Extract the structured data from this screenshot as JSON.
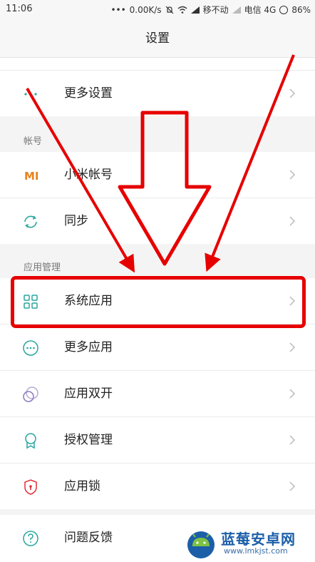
{
  "status_bar": {
    "time": "11:06",
    "dots": "•••",
    "speed": "0.00K/s",
    "carrier1": "移不动",
    "carrier2": "电信 4G",
    "battery": "86%"
  },
  "title": "设置",
  "sections": {
    "more_settings": "更多设置",
    "account_header": "帐号",
    "mi_account": "小米帐号",
    "sync": "同步",
    "app_header": "应用管理",
    "system_apps": "系统应用",
    "more_apps": "更多应用",
    "dual_apps": "应用双开",
    "permissions": "授权管理",
    "app_lock": "应用锁",
    "feedback": "问题反馈"
  },
  "icons": {
    "mi_logo": "MI"
  },
  "watermark": {
    "title": "蓝莓安卓网",
    "url": "www.lmkjst.com"
  },
  "colors": {
    "accent": "#e60000",
    "icon_teal": "#2aa6a0",
    "watermark_blue": "#1c5fa8"
  }
}
